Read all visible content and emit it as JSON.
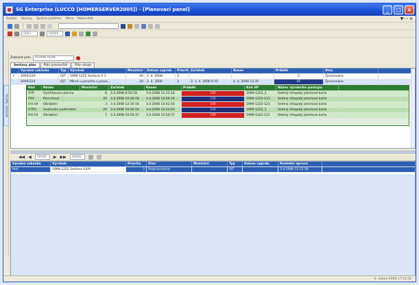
{
  "window": {
    "title": "SG Enterprise (LUCCO [HOMERSERVER2005]) - [Planovaci panel]"
  },
  "menu": {
    "items": [
      "Soubor",
      "Úpravy",
      "Správa systému",
      "Okna",
      "Nápověda"
    ],
    "right_marker": "▼· · ×"
  },
  "toolbar": {
    "combo_value": "",
    "date_from": "0001",
    "date_to": "00000"
  },
  "filter": {
    "label": "Zobrazit plán",
    "value": "HLAVNÍ PLÁN"
  },
  "sidebar": {
    "vertical_tab": "Služby zakázek"
  },
  "tabs": [
    "Sestavy plán",
    "Plán pracoviště",
    "Plán stroje"
  ],
  "top_grid": {
    "columns": [
      "",
      "Výrobní zakázka",
      "Typ",
      "Výrobek",
      "Množství",
      "Datum vyprob.",
      "Priorita",
      "Začátek",
      "Konec",
      "Průběh",
      "Stav"
    ],
    "rows": [
      [
        "+",
        "2005/229",
        "OJT",
        "1999-1222 Sestava A 3",
        "40",
        "2. 4. 2008",
        "3",
        "",
        "",
        "0",
        "Zpracováno"
      ],
      [
        "-",
        "2005/224",
        "OJT",
        "Mírné u porucha v provo...",
        "20",
        "2. 4. 2008",
        "3",
        "3. 3. 4. 2008 6:55",
        "4. 4. 2008 12:35",
        "60",
        "Zpracováno"
      ]
    ]
  },
  "nested_grid": {
    "columns": [
      "Kód",
      "Název",
      "Množství",
      "Začátek",
      "Konec",
      "Průběh",
      "Kód VP",
      "Název výrobního postupu"
    ],
    "rows": [
      [
        "VYP",
        "Vystřihování plechu",
        "6",
        "3.4.2008 8:50:18",
        "3.4.2008 11:23:18",
        "100",
        "1999-1222_1",
        "Sedmý chlupatý plechová karta"
      ],
      [
        "POV",
        "Povrchová",
        "20",
        "3.4.2008 10:26:18",
        "3.4.2008 14:26:18",
        "100",
        "1999-1222-121",
        "Sedmý chlupatý plechová karta"
      ],
      [
        "OH-19",
        "Obrábění",
        "3",
        "3.4.2008 12:10:16",
        "3.4.2008 13:42:16",
        "100",
        "1999-1222-121",
        "Sedmý chlupatý plechová karta"
      ],
      [
        "STPO",
        "Svařování podmínění",
        "20",
        "3.4.2008 10:40:18",
        "3.4.2008 14:23:03",
        "100",
        "1999-1222_1",
        "Sedmý chlupatý plechová karta"
      ],
      [
        "OH-19",
        "Obrábění",
        "7",
        "3.4.2008 10:50:37",
        "3.4.2008 15:50:37",
        "100",
        "1999-1222-121",
        "Sedmý chlupatý plechová karta"
      ]
    ]
  },
  "navbar": {
    "value1": "00000",
    "value2": "00000"
  },
  "bottom_grid": {
    "columns": [
      "Výrobní zakázka",
      "Výrobek",
      "Priorita",
      "Stav",
      "Množství",
      "Typ",
      "Datum vyprob.",
      "Poslední úprava"
    ],
    "rows": [
      [
        "test",
        "1999-1222 Sestava A3/H",
        "3",
        "Rozpracována",
        "",
        "OJT",
        "",
        "3.4.2008 12:15:18"
      ]
    ]
  },
  "status": {
    "left": "",
    "right": "3. duben 2008 17:11:50"
  }
}
